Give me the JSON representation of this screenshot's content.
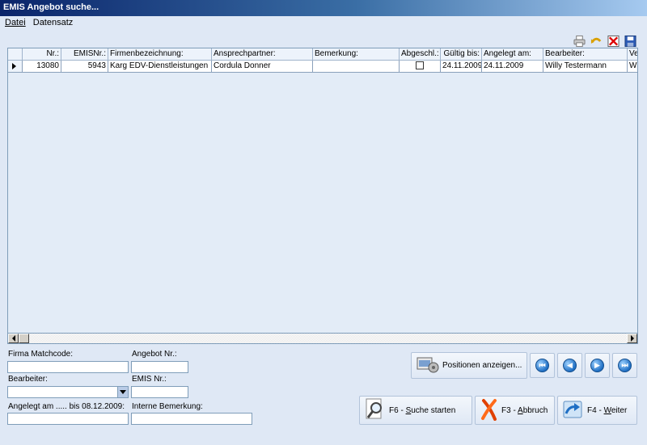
{
  "window": {
    "title": "EMIS Angebot suche..."
  },
  "menu": {
    "file": "Datei",
    "record": "Datensatz"
  },
  "grid": {
    "headers": {
      "nr": "Nr.:",
      "emisnr": "EMISNr.:",
      "firma": "Firmenbezeichnung:",
      "ansprech": "Ansprechpartner:",
      "bemerkung": "Bemerkung:",
      "abgeschl": "Abgeschl.:",
      "gueltig": "Gültig bis:",
      "angelegt": "Angelegt am:",
      "bearbeiter": "Bearbeiter:",
      "ve": "Ve"
    },
    "rows": [
      {
        "nr": "13080",
        "emisnr": "5943",
        "firma": "Karg EDV-Dienstleistungen",
        "ansprech": "Cordula Donner",
        "bemerkung": "",
        "abgeschl": false,
        "gueltig": "24.11.2009",
        "angelegt": "24.11.2009",
        "bearbeiter": "Willy Testermann",
        "ve": "Wi"
      }
    ]
  },
  "form": {
    "firma_label": "Firma Matchcode:",
    "firma_value": "",
    "angebot_label": "Angebot Nr.:",
    "angebot_value": "",
    "bearbeiter_label": "Bearbeiter:",
    "bearbeiter_value": "",
    "emis_label": "EMIS Nr.:",
    "emis_value": "",
    "angelegt_label": "Angelegt am ..... bis 08.12.2009:",
    "angelegt_from": "",
    "angelegt_to": "",
    "interne_label": "Interne Bemerkung:",
    "interne_value": ""
  },
  "buttons": {
    "positionen": "Positionen anzeigen...",
    "suche_key": "F6 - ",
    "suche_u": "S",
    "suche_rest": "uche starten",
    "abbruch_key": "F3 - ",
    "abbruch_u": "A",
    "abbruch_rest": "bbruch",
    "weiter_key": "F4 - ",
    "weiter_u": "W",
    "weiter_rest": "eiter"
  },
  "icons": {
    "toolbar": [
      "printer-icon",
      "undo-icon",
      "delete-icon",
      "save-icon"
    ],
    "nav": [
      "first-record-icon",
      "prev-record-icon",
      "next-record-icon",
      "last-record-icon"
    ]
  }
}
